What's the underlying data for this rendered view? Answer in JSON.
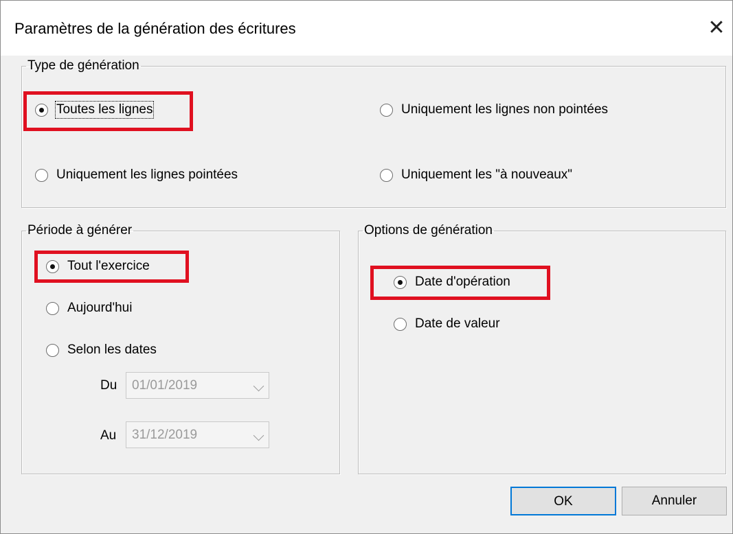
{
  "dialog": {
    "title": "Paramètres de la génération des écritures"
  },
  "type_generation": {
    "legend": "Type de génération",
    "options": [
      {
        "label": "Toutes les lignes",
        "checked": true
      },
      {
        "label": "Uniquement les lignes non pointées",
        "checked": false
      },
      {
        "label": "Uniquement les lignes pointées",
        "checked": false
      },
      {
        "label": "Uniquement les \"à nouveaux\"",
        "checked": false
      }
    ]
  },
  "periode": {
    "legend": "Période à générer",
    "options": [
      {
        "label": "Tout l'exercice",
        "checked": true
      },
      {
        "label": "Aujourd'hui",
        "checked": false
      },
      {
        "label": "Selon les dates",
        "checked": false
      }
    ],
    "du_label": "Du",
    "du_value": "01/01/2019",
    "au_label": "Au",
    "au_value": "31/12/2019"
  },
  "options_generation": {
    "legend": "Options de génération",
    "options": [
      {
        "label": "Date d'opération",
        "checked": true
      },
      {
        "label": "Date de valeur",
        "checked": false
      }
    ]
  },
  "buttons": {
    "ok": "OK",
    "cancel": "Annuler"
  },
  "colors": {
    "highlight": "#e01020",
    "focus_border": "#0078d7"
  }
}
